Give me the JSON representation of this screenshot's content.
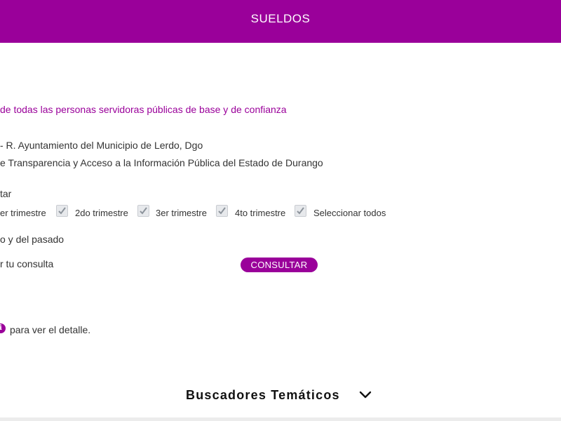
{
  "header": {
    "title": "SUELDOS"
  },
  "colors": {
    "accent": "#9a009a",
    "text": "#333333"
  },
  "description": "de todas las personas servidoras públicas de base y de confianza",
  "entity": "- R. Ayuntamiento del Municipio de Lerdo, Dgo",
  "law": "e Transparencia y Acceso a la Información Pública del Estado de Durango",
  "period_prompt": "tar",
  "quarters": {
    "q1_label": "er trimestre",
    "q2_label": "2do trimestre",
    "q3_label": "3er trimestre",
    "q4_label": "4to trimestre",
    "select_all_label": "Seleccionar todos"
  },
  "year_text": "o y del pasado",
  "query_prompt": "r tu consulta",
  "consult_button": "CONSULTAR",
  "detail_hint": "para ver el detalle.",
  "info_icon_glyph": "i",
  "buscadores": {
    "label": "Buscadores Temáticos",
    "icon": "chevron-down-icon"
  }
}
